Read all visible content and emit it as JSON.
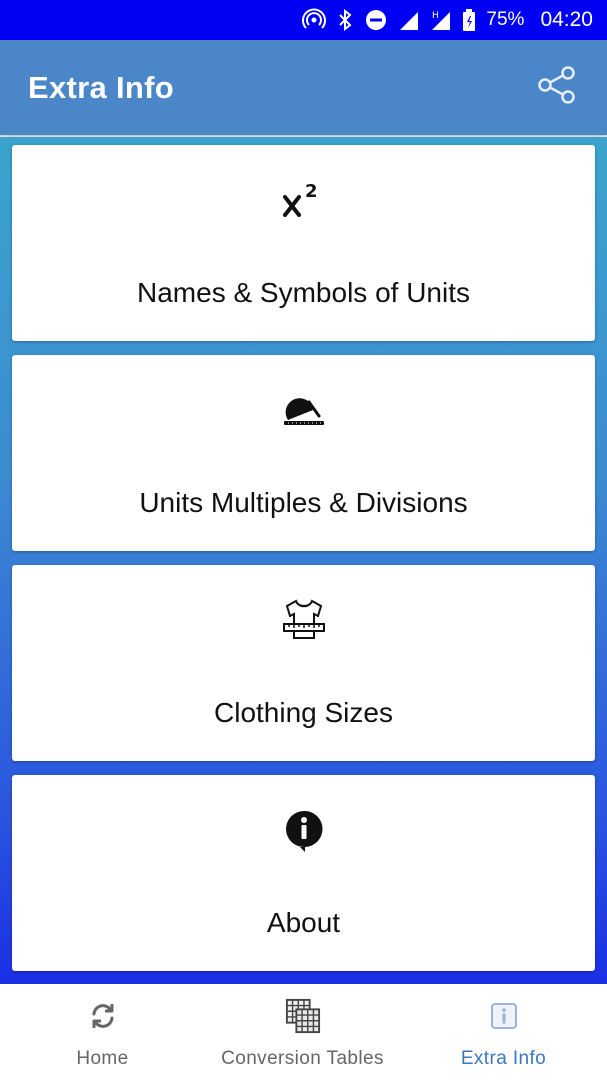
{
  "status_bar": {
    "battery": "75%",
    "time": "04:20",
    "icons": [
      "hotspot-icon",
      "bluetooth-icon",
      "do-not-disturb-icon",
      "signal-icon",
      "signal-h-icon",
      "battery-icon"
    ]
  },
  "app_bar": {
    "title": "Extra Info",
    "share_icon": "share-icon"
  },
  "cards": [
    {
      "label": "Names & Symbols of Units",
      "icon": "superscript-icon"
    },
    {
      "label": "Units Multiples & Divisions",
      "icon": "protractor-icon"
    },
    {
      "label": "Clothing Sizes",
      "icon": "shirt-measure-icon"
    },
    {
      "label": "About",
      "icon": "info-bubble-icon"
    }
  ],
  "bottom_nav": {
    "items": [
      {
        "label": "Home",
        "icon": "refresh-icon",
        "active": false
      },
      {
        "label": "Conversion Tables",
        "icon": "table-icon",
        "active": false
      },
      {
        "label": "Extra Info",
        "icon": "info-icon",
        "active": true
      }
    ]
  },
  "colors": {
    "status_bar": "#0000f2",
    "app_bar": "#4a86c8",
    "active_nav": "#3b78c0",
    "inactive_nav": "#666666"
  }
}
